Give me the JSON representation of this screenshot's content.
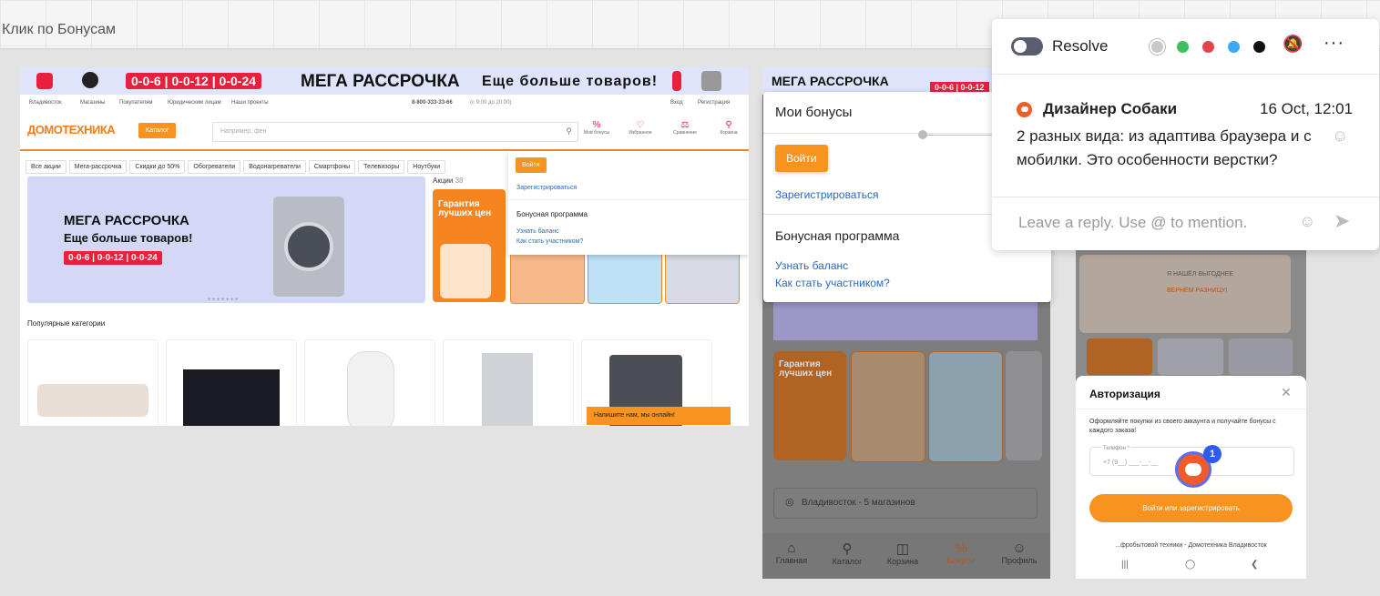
{
  "frame": {
    "title": "Клик по Бонусам"
  },
  "desktop": {
    "promo": {
      "codes": "0-0-6 | 0-0-12 | 0-0-24",
      "headline": "МЕГА РАССРОЧКА",
      "tagline": "Еще больше товаров!"
    },
    "topnav": {
      "city": "Владивосток",
      "items": [
        "Магазины",
        "Покупателям",
        "Юридическим лицам",
        "Наши проекты"
      ],
      "phone": "8-800-333-33-66",
      "hours": "(с 9:00 до 20:00)",
      "login": "Вход",
      "register": "Регистрация"
    },
    "logo": "ДОМОТЕХНИКА",
    "catalog_btn": "Каталог",
    "search_placeholder": "Например, фен",
    "header_icons": [
      {
        "icon": "percent-icon",
        "label": "Мои бонусы"
      },
      {
        "icon": "heart-icon",
        "label": "Избранное"
      },
      {
        "icon": "compare-icon",
        "label": "Сравнение"
      },
      {
        "icon": "cart-icon",
        "label": "Корзина"
      }
    ],
    "chips": [
      "Все акции",
      "Мега-рассрочка",
      "Скидки до 50%",
      "Обогреватели",
      "Водонагреватели",
      "Смартфоны",
      "Телевизоры",
      "Ноутбуки"
    ],
    "hero": {
      "title": "МЕГА РАССРОЧКА",
      "subtitle": "Еще больше товаров!",
      "codes": "0-0-6 | 0-0-12 | 0-0-24"
    },
    "aktsii": {
      "label": "Акции",
      "count": "38"
    },
    "promo_card_title": "Гарантия лучших цен",
    "popular_title": "Популярные категории",
    "chat": "Напишите нам, мы онлайн!",
    "dropdown": {
      "login": "Войти",
      "register": "Зарегистрироваться",
      "bonus_program": "Бонусная программа",
      "balance": "Узнать баланс",
      "join": "Как стать участником?"
    }
  },
  "mobile": {
    "headline": "МЕГА РАССРОЧКА",
    "codes": "0-0-6 | 0-0-12",
    "card_title": "Гарантия лучших цен",
    "city": "Владивосток - 5 магазинов",
    "tabs": [
      {
        "icon": "home-icon",
        "label": "Главная"
      },
      {
        "icon": "search-icon",
        "label": "Каталог"
      },
      {
        "icon": "cart-icon",
        "label": "Корзина"
      },
      {
        "icon": "percent-icon",
        "label": "Бонусы",
        "active": true
      },
      {
        "icon": "profile-icon",
        "label": "Профиль"
      }
    ],
    "panel": {
      "title": "Мои бонусы",
      "login": "Войти",
      "register": "Зарегистрироваться",
      "bonus_program": "Бонусная программа",
      "balance": "Узнать баланс",
      "join": "Как стать участником?"
    }
  },
  "app": {
    "found_cheaper": "Я НАШЁЛ ВЫГОДНЕЕ",
    "refund": "ВЕРНЁМ РАЗНИЦУ!",
    "modal": {
      "title": "Авторизация",
      "desc": "Оформляйте покупки из своего аккаунта и получайте бонусы с каждого заказа!",
      "phone_label": "Телефон *",
      "phone_value": "+7 (9__) ___-__-__",
      "button": "Войти или зарегистрировать",
      "footer": "...фробытовой техники - Домотехника Владивосток"
    }
  },
  "marker": {
    "count": "1"
  },
  "comment": {
    "resolve_label": "Resolve",
    "colors": [
      "#c9c9c9",
      "#3dbf5e",
      "#e0454a",
      "#3aa9f2",
      "#111111"
    ],
    "author": "Дизайнер Собаки",
    "date": "16 Oct, 12:01",
    "body": "2 разных вида: из адаптива браузера и с мобилки. Это особенности верстки?",
    "reply_placeholder": "Leave a reply. Use @ to mention."
  }
}
